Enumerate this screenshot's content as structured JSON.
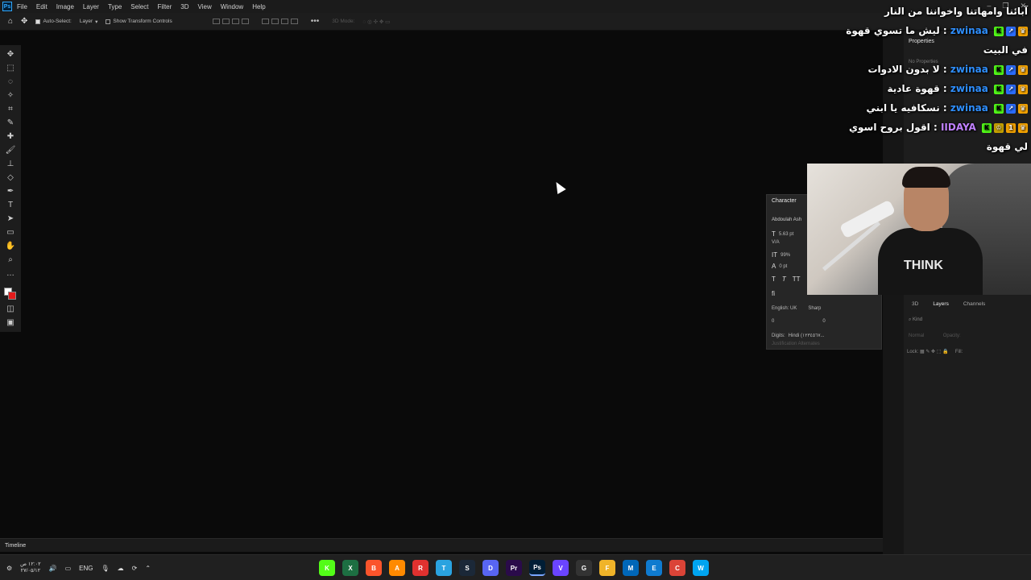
{
  "app": {
    "logo": "Ps",
    "menu": [
      "File",
      "Edit",
      "Image",
      "Layer",
      "Type",
      "Select",
      "Filter",
      "3D",
      "View",
      "Window",
      "Help"
    ]
  },
  "options_bar": {
    "auto_select_label": "Auto-Select:",
    "auto_select_target": "Layer",
    "show_transform_label": "Show Transform Controls",
    "mode_3d_label": "3D Mode:"
  },
  "properties_panel": {
    "title": "Properties",
    "empty_text": "No Properties"
  },
  "character_panel": {
    "title": "Character",
    "font_family": "Abdoulah Ash",
    "font_size": "5.63 pt",
    "leading_label": "V/A",
    "scale": "99%",
    "baseline": "0 pt",
    "language": "English: UK",
    "antialias": "Sharp",
    "indent_left": "0",
    "indent_right": "0",
    "digits_label": "Digits:",
    "digits_value": "Hindi (١٢٣٤٥٦٧...",
    "justification": "Justification Alternates"
  },
  "layers_panel": {
    "tabs": [
      "3D",
      "Layers",
      "Channels"
    ],
    "active_tab": "Layers",
    "kind_placeholder": "Kind",
    "blend_mode": "Normal",
    "opacity_label": "Opacity:",
    "lock_label": "Lock:",
    "fill_label": "Fill:"
  },
  "timeline": {
    "label": "Timeline"
  },
  "chat": [
    {
      "user": "",
      "message": "آبائنا وامهاتنا واخواننا من النار",
      "user_color": "#ffffff"
    },
    {
      "user": "zwinaa",
      "message": "ليش ما تسوي قهوة في البيت",
      "user_color": "#2f8fff"
    },
    {
      "user": "zwinaa",
      "message": "لا بدون الادوات",
      "user_color": "#2f8fff"
    },
    {
      "user": "zwinaa",
      "message": "قهوة عادية",
      "user_color": "#2f8fff"
    },
    {
      "user": "zwinaa",
      "message": "نسكافيه يا ابني",
      "user_color": "#2f8fff"
    },
    {
      "user": "IIDAYA",
      "message": "اقول بروح اسوي لي قهوة",
      "user_color": "#c081ff"
    }
  ],
  "webcam": {
    "shirt_text": "THINK"
  },
  "taskbar": {
    "language": "ENG",
    "clock_time": "١٢:٠٢ ص",
    "clock_date": "٢٧/٠٥/١٢",
    "apps": [
      {
        "label": "K",
        "color": "#53fc18"
      },
      {
        "label": "X",
        "color": "#1d6f42"
      },
      {
        "label": "B",
        "color": "#fb542b"
      },
      {
        "label": "A",
        "color": "#ff8a00"
      },
      {
        "label": "R",
        "color": "#e0312f"
      },
      {
        "label": "T",
        "color": "#2aa3e0"
      },
      {
        "label": "S",
        "color": "#1b2838"
      },
      {
        "label": "D",
        "color": "#5865f2"
      },
      {
        "label": "Pr",
        "color": "#2a0b4a"
      },
      {
        "label": "Ps",
        "color": "#001e36"
      },
      {
        "label": "V",
        "color": "#6a44ff"
      },
      {
        "label": "G",
        "color": "#333333"
      },
      {
        "label": "F",
        "color": "#f0b429"
      },
      {
        "label": "M",
        "color": "#0067b8"
      },
      {
        "label": "E",
        "color": "#0f7bcf"
      },
      {
        "label": "C",
        "color": "#db4437"
      },
      {
        "label": "W",
        "color": "#00a4ef"
      }
    ]
  }
}
